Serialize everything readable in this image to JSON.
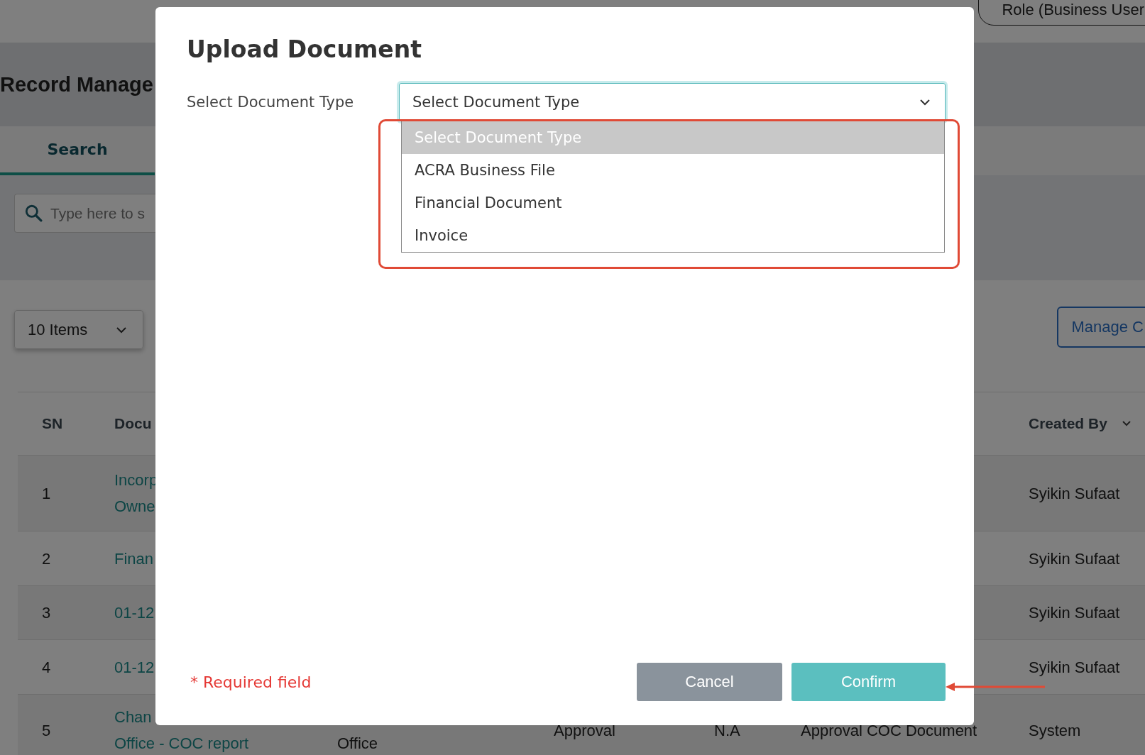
{
  "page": {
    "role_pill": "Role (Business User",
    "title": "Record Manage",
    "tabs": [
      {
        "label": "Search",
        "selected": true
      }
    ],
    "search": {
      "placeholder": "Type here to s"
    },
    "page_size": "10 Items",
    "manage_button": "Manage C"
  },
  "table": {
    "columns": [
      "SN",
      "Docu",
      "Created By"
    ],
    "rows": [
      {
        "sn": "1",
        "document": [
          "Incorp",
          "Owne"
        ],
        "created_by": "Syikin Sufaat"
      },
      {
        "sn": "2",
        "document": [
          "Finan"
        ],
        "created_by": "Syikin Sufaat"
      },
      {
        "sn": "3",
        "document": [
          "01-12"
        ],
        "created_by": "Syikin Sufaat"
      },
      {
        "sn": "4",
        "document": [
          "01-12"
        ],
        "created_by": "Syikin Sufaat"
      },
      {
        "sn": "5",
        "document": [
          "Chan",
          "Office - COC report"
        ],
        "column_3": "Office",
        "column_4": "Approval",
        "column_5": "N.A",
        "column_6": "Approval COC Document",
        "created_by": "System"
      }
    ]
  },
  "dialog": {
    "title": "Upload Document",
    "field_label": "Select Document Type",
    "select": {
      "value": "Select Document Type",
      "expanded": true
    },
    "options": [
      {
        "label": "Select Document Type",
        "selected": true
      },
      {
        "label": "ACRA Business File",
        "selected": false
      },
      {
        "label": "Financial Document",
        "selected": false
      },
      {
        "label": "Invoice",
        "selected": false
      }
    ],
    "required_note": "* Required field",
    "buttons": [
      {
        "label": "Cancel",
        "kind": "secondary"
      },
      {
        "label": "Confirm",
        "kind": "primary"
      }
    ]
  }
}
